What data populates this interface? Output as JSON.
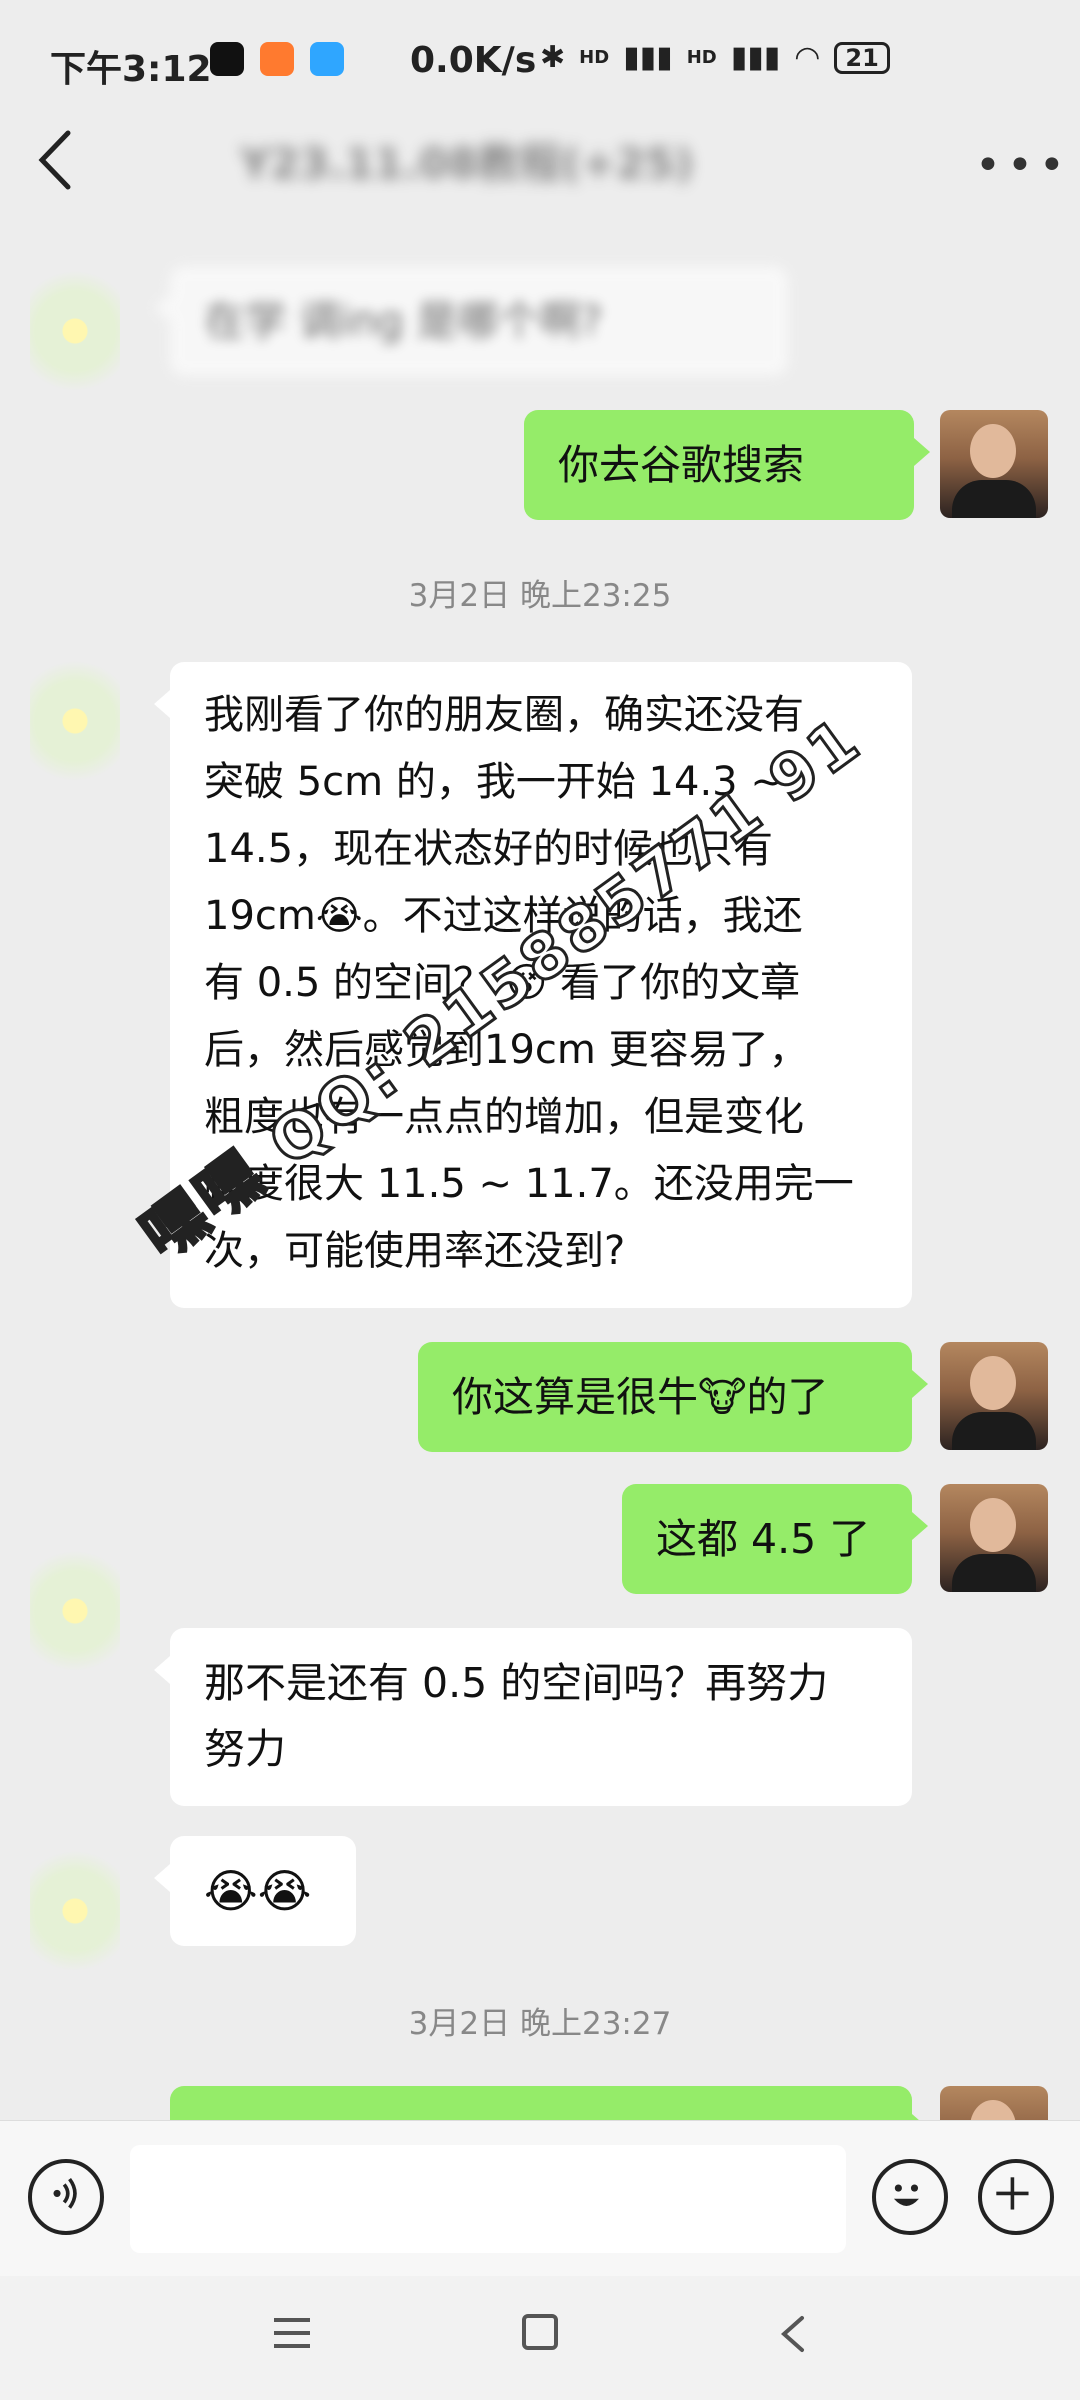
{
  "status_bar": {
    "time": "下午3:12",
    "network_speed": "0.0K/s",
    "signal_1": "HD",
    "signal_2": "HD",
    "battery": "21",
    "icons": [
      "tiktok-icon",
      "app-icon-orange",
      "app-icon-blue",
      "bluetooth-icon",
      "signal-icon",
      "signal-icon",
      "wifi-icon",
      "battery-icon"
    ]
  },
  "header": {
    "title": "Y23.11.08教程(+25)",
    "back_icon": "back-arrow-icon",
    "more_icon": "more-icon"
  },
  "messages": [
    {
      "side": "left",
      "text": "在学 调ing 是哪个啊?"
    },
    {
      "side": "right",
      "text": "你去谷歌搜索"
    },
    {
      "type": "timestamp",
      "text": "3月2日 晚上23:25"
    },
    {
      "side": "left",
      "text": "我刚看了你的朋友圈，确实还没有\n突破 5cm 的，我一开始 14.3 ~\n14.5，现在状态好的时候也只有\n19cm😭。不过这样说的话，我还\n有 0.5 的空间？ 😵 看了你的文章\n后，然后感觉到19cm 更容易了，\n粗度也有一点点的增加，但是变化\n幅度很大 11.5 ~ 11.7。还没用完一\n次，可能使用率还没到?"
    },
    {
      "side": "right",
      "text": "你这算是很牛🐮的了"
    },
    {
      "side": "right",
      "text": "这都 4.5 了"
    },
    {
      "side": "left",
      "text": "那不是还有 0.5 的空间吗？再努力\n努力"
    },
    {
      "side": "left",
      "text": "😭😭"
    },
    {
      "type": "timestamp",
      "text": "3月2日 晚上23:27"
    }
  ],
  "watermark": "嘿嘿 QQ: 215885771 91",
  "input_bar": {
    "voice_icon": "voice-icon",
    "input_value": "",
    "emoji_icon": "emoji-icon",
    "plus_icon": "plus-icon"
  },
  "nav_bar": {
    "menu_icon": "menu-icon",
    "home_icon": "home-icon",
    "back_icon": "back-icon"
  },
  "colors": {
    "background": "#ededed",
    "bubble_self": "#95ec69",
    "bubble_other": "#ffffff",
    "timestamp": "#888888"
  }
}
